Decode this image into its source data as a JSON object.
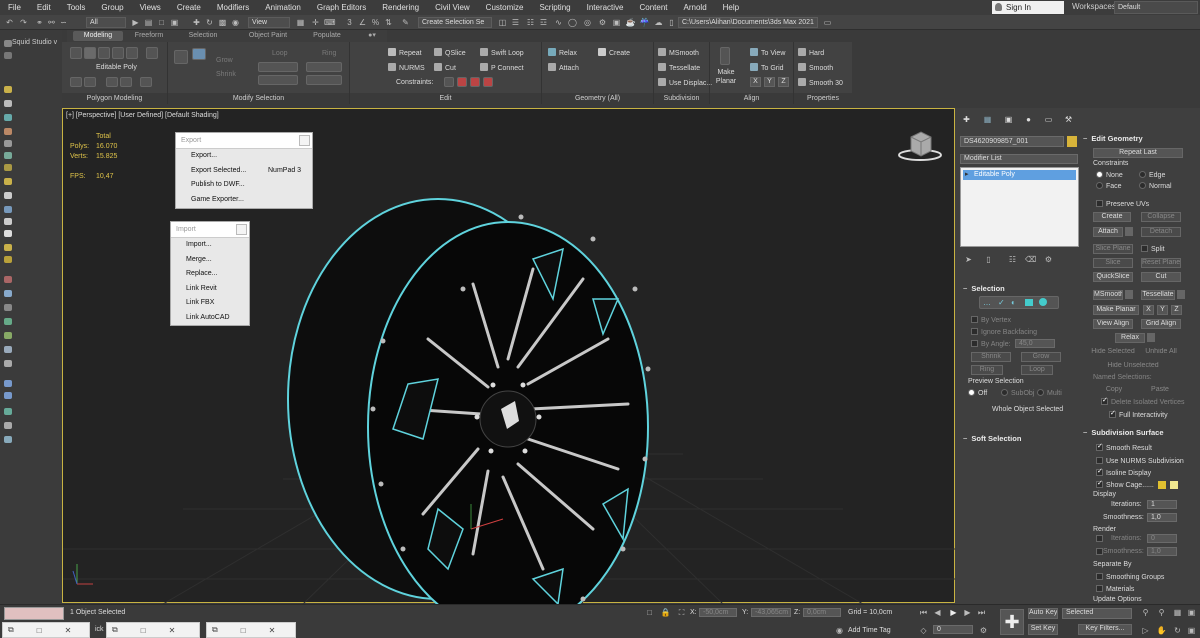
{
  "menubar": {
    "items": [
      "File",
      "Edit",
      "Tools",
      "Group",
      "Views",
      "Create",
      "Modifiers",
      "Animation",
      "Graph Editors",
      "Rendering",
      "Civil View",
      "Customize",
      "Scripting",
      "Interactive",
      "Content",
      "Arnold",
      "Help"
    ],
    "signin": "Sign In",
    "workspaces_label": "Workspaces:",
    "workspaces_value": "Default"
  },
  "toolbar": {
    "selection_filter": "All",
    "ref_coord": "View",
    "named_selection": "Create Selection Se",
    "project_path": "C:\\Users\\Alihan\\Documents\\3ds Max 2021"
  },
  "ribbon": {
    "tabs": [
      "Modeling",
      "Freeform",
      "Selection",
      "Object Paint",
      "Populate"
    ],
    "editable_poly": "Editable Poly",
    "grow": "Grow",
    "shrink": "Shrink",
    "loop": "Loop",
    "ring": "Ring",
    "repeat": "Repeat",
    "qslice": "QSlice",
    "swift_loop": "Swift Loop",
    "nurms": "NURMS",
    "cut": "Cut",
    "p_connect": "P Connect",
    "constraints": "Constraints:",
    "relax": "Relax",
    "create": "Create",
    "attach": "Attach",
    "msmooth": "MSmooth",
    "tessellate": "Tessellate",
    "use_displac": "Use Displac...",
    "make_planar": "Make Planar",
    "to_view": "To View",
    "to_grid": "To Grid",
    "hard": "Hard",
    "smooth": "Smooth",
    "smooth30": "Smooth 30",
    "x": "X",
    "y": "Y",
    "z": "Z",
    "panels": [
      "Polygon Modeling",
      "Modify Selection",
      "Edit",
      "Geometry (All)",
      "Subdivision",
      "Align",
      "Properties"
    ]
  },
  "left_panel": {
    "title": "Squid Studio v"
  },
  "viewport": {
    "label": "[+] [Perspective] [User Defined] [Default Shading]",
    "stats_total": "Total",
    "polys_label": "Polys:",
    "polys_value": "16.070",
    "verts_label": "Verts:",
    "verts_value": "15.825",
    "fps_label": "FPS:",
    "fps_value": "10,47"
  },
  "export_menu": {
    "title": "Export",
    "items": [
      "Export...",
      "Export Selected...",
      "Publish to DWF...",
      "Game Exporter..."
    ],
    "shortcut": "NumPad 3"
  },
  "import_menu": {
    "title": "Import",
    "items": [
      "Import...",
      "Merge...",
      "Replace...",
      "Link Revit",
      "Link FBX",
      "Link AutoCAD"
    ]
  },
  "command_panel": {
    "object_name": "DS4620909857_001",
    "modifier_list": "Modifier List",
    "stack_item": "Editable Poly",
    "selection": {
      "title": "Selection",
      "by_vertex": "By Vertex",
      "ignore_backfacing": "Ignore Backfacing",
      "by_angle": "By Angle:",
      "by_angle_value": "45,0",
      "shrink": "Shrink",
      "grow": "Grow",
      "ring": "Ring",
      "loop": "Loop",
      "preview_selection": "Preview Selection",
      "off": "Off",
      "subobj": "SubObj",
      "multi": "Multi",
      "whole_object": "Whole Object Selected"
    },
    "soft_selection": "Soft Selection",
    "edit_geometry": {
      "title": "Edit Geometry",
      "repeat_last": "Repeat Last",
      "constraints": "Constraints",
      "none": "None",
      "edge": "Edge",
      "face": "Face",
      "normal": "Normal",
      "preserve_uvs": "Preserve UVs",
      "create": "Create",
      "collapse": "Collapse",
      "attach": "Attach",
      "detach": "Detach",
      "slice_plane": "Slice Plane",
      "split": "Split",
      "slice": "Slice",
      "reset_plane": "Reset Plane",
      "quickslice": "QuickSlice",
      "cut": "Cut",
      "msmooth": "MSmooth",
      "tessellate": "Tessellate",
      "make_planar": "Make Planar",
      "x": "X",
      "y": "Y",
      "z": "Z",
      "view_align": "View Align",
      "grid_align": "Grid Align",
      "relax": "Relax",
      "hide_selected": "Hide Selected",
      "unhide_all": "Unhide All",
      "hide_unselected": "Hide Unselected",
      "named_selections": "Named Selections:",
      "copy": "Copy",
      "paste": "Paste",
      "delete_isolated": "Delete Isolated Vertices",
      "full_interactivity": "Full Interactivity"
    },
    "subdivision_surface": {
      "title": "Subdivision Surface",
      "smooth_result": "Smooth Result",
      "use_nurms": "Use NURMS Subdivision",
      "isoline_display": "Isoline Display",
      "show_cage": "Show Cage......",
      "display": "Display",
      "iterations": "Iterations:",
      "iterations_value": "1",
      "smoothness": "Smoothness:",
      "smoothness_value": "1,0",
      "render": "Render",
      "render_iterations_value": "0",
      "render_smoothness_value": "1,0",
      "separate_by": "Separate By",
      "smoothing_groups": "Smoothing Groups",
      "materials": "Materials",
      "update_options": "Update Options"
    }
  },
  "statusbar": {
    "selected": "1 Object Selected",
    "x_label": "X:",
    "x_value": "-50,0cm",
    "y_label": "Y:",
    "y_value": "-43,065cm",
    "z_label": "Z:",
    "z_value": "0,0cm",
    "grid": "Grid = 10,0cm",
    "add_time_tag": "Add Time Tag",
    "frame": "0",
    "auto_key": "Auto Key",
    "selected_dropdown": "Selected",
    "set_key": "Set Key",
    "key_filters": "Key Filters...",
    "partial_text": "ick"
  },
  "colors": {
    "accent_yellow": "#c8b342",
    "selection_cyan": "#5fd3dd",
    "viewport_bg": "#232323"
  }
}
